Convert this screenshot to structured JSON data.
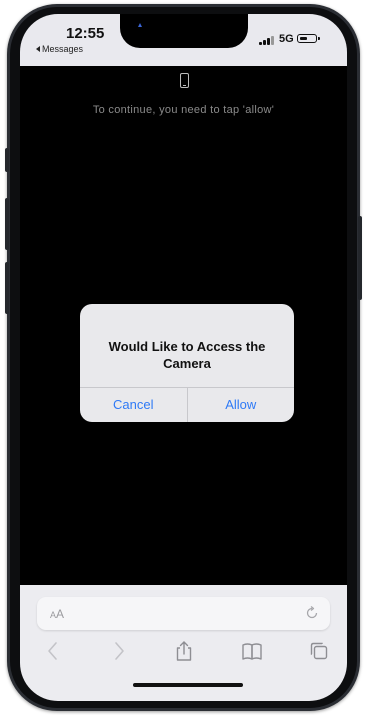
{
  "status_bar": {
    "time": "12:55",
    "back_label": "Messages",
    "network": "5G"
  },
  "page": {
    "device_icon": "smartphone-icon",
    "instruction": "To continue, you need to tap 'allow'"
  },
  "alert": {
    "title": "Would Like to Access the Camera",
    "cancel_label": "Cancel",
    "allow_label": "Allow"
  },
  "toolbar": {
    "text_size_label_small": "A",
    "text_size_label_large": "A",
    "icons": [
      "back-icon",
      "forward-icon",
      "share-icon",
      "bookmarks-icon",
      "tabs-icon"
    ],
    "reload_icon": "reload-icon"
  },
  "colors": {
    "accent_blue": "#2f7af6",
    "screen_background": "#000000",
    "alert_background": "#e9e9ec",
    "toolbar_background": "#ececf0"
  }
}
